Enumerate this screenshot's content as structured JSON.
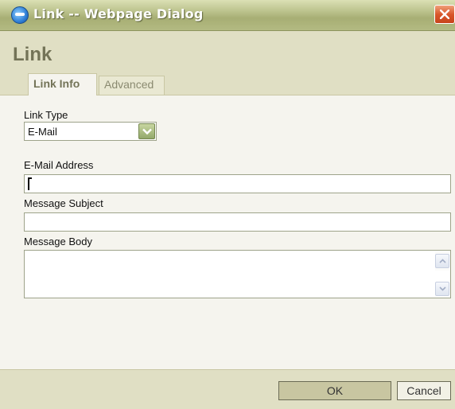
{
  "window": {
    "title": "Link -- Webpage Dialog"
  },
  "dialog": {
    "title": "Link",
    "tabs": [
      {
        "label": "Link Info",
        "active": true
      },
      {
        "label": "Advanced",
        "active": false
      }
    ]
  },
  "form": {
    "link_type_label": "Link Type",
    "link_type_value": "E-Mail",
    "email_label": "E-Mail Address",
    "email_value": "",
    "subject_label": "Message Subject",
    "subject_value": "",
    "body_label": "Message Body",
    "body_value": ""
  },
  "footer": {
    "ok_label": "OK",
    "cancel_label": "Cancel"
  },
  "colors": {
    "titlebar": "#b9c08a",
    "header": "#e0dfc4",
    "content": "#f5f4ee",
    "close": "#d9572b"
  },
  "icons": {
    "window_icon": "ie-logo-icon",
    "close": "close-icon",
    "dropdown": "chevron-down-icon",
    "scroll_up": "chevron-up-icon",
    "scroll_down": "chevron-down-icon"
  }
}
